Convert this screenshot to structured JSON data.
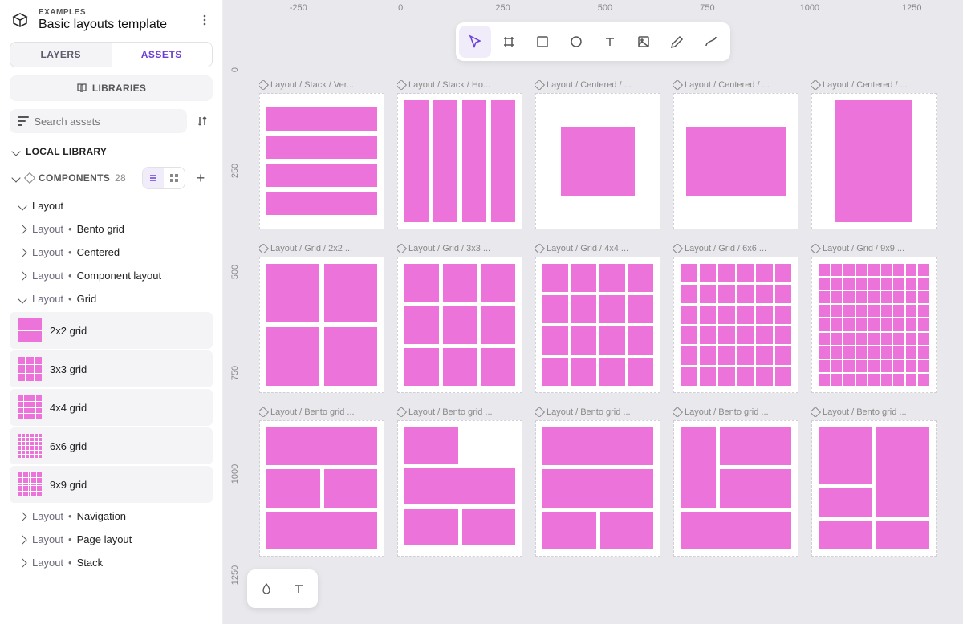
{
  "header": {
    "examples": "EXAMPLES",
    "title": "Basic layouts template"
  },
  "tabs": {
    "layers": "LAYERS",
    "assets": "ASSETS"
  },
  "libraries_btn": "LIBRARIES",
  "search": {
    "placeholder": "Search assets"
  },
  "local_library": "LOCAL LIBRARY",
  "components": {
    "label": "COMPONENTS",
    "count": "28"
  },
  "tree": {
    "layout": "Layout",
    "prefix": "Layout",
    "sep": "•",
    "bento": "Bento grid",
    "centered": "Centered",
    "component_layout": "Component layout",
    "grid": "Grid",
    "g2": "2x2 grid",
    "g3": "3x3 grid",
    "g4": "4x4 grid",
    "g6": "6x6 grid",
    "g9": "9x9 grid",
    "navigation": "Navigation",
    "page_layout": "Page layout",
    "stack": "Stack"
  },
  "ruler_h": [
    "-250",
    "0",
    "250",
    "500",
    "750",
    "1000",
    "1250"
  ],
  "ruler_v": [
    "0",
    "250",
    "500",
    "750",
    "1000",
    "1250"
  ],
  "frames": {
    "r1c1": "Layout / Stack / Ver...",
    "r1c2": "Layout / Stack / Ho...",
    "r1c3": "Layout / Centered / ...",
    "r1c4": "Layout / Centered / ...",
    "r1c5": "Layout / Centered / ...",
    "r2c1": "Layout / Grid / 2x2 ...",
    "r2c2": "Layout / Grid / 3x3 ...",
    "r2c3": "Layout / Grid / 4x4 ...",
    "r2c4": "Layout / Grid / 6x6 ...",
    "r2c5": "Layout / Grid / 9x9 ...",
    "r3c1": "Layout / Bento grid ...",
    "r3c2": "Layout / Bento grid ...",
    "r3c3": "Layout / Bento grid ...",
    "r3c4": "Layout / Bento grid ...",
    "r3c5": "Layout / Bento grid ..."
  }
}
